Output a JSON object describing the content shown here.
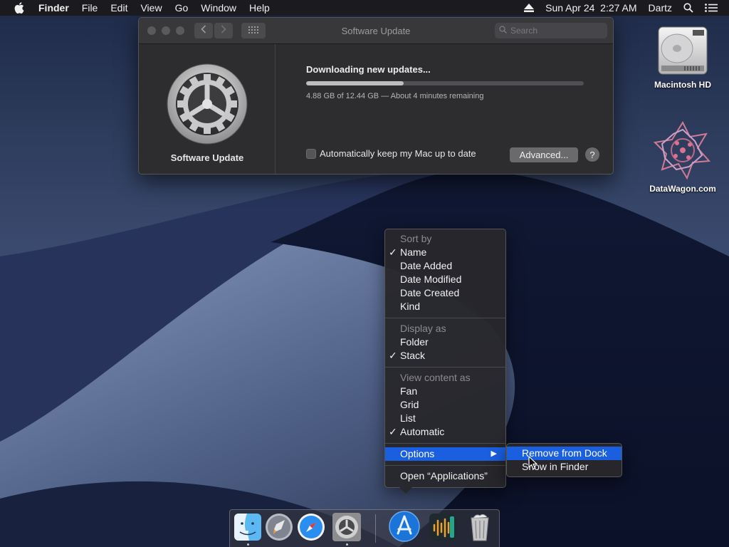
{
  "menubar": {
    "app_name": "Finder",
    "menus": [
      "File",
      "Edit",
      "View",
      "Go",
      "Window",
      "Help"
    ],
    "datetime": "Sun Apr 24  2:27 AM",
    "user": "Dartz"
  },
  "window": {
    "title": "Software Update",
    "search_placeholder": "Search",
    "app_name": "Software Update",
    "status_title": "Downloading new updates...",
    "progress_fraction": 0.35,
    "progress_text": "4.88 GB of 12.44 GB — About 4 minutes remaining",
    "auto_update_label": "Automatically keep my Mac up to date",
    "auto_update_checked": false,
    "advanced_label": "Advanced...",
    "help_label": "?"
  },
  "desktop": {
    "icons": [
      {
        "label": "Macintosh HD"
      },
      {
        "label": "DataWagon.com"
      }
    ]
  },
  "context_menu": {
    "sort_header": "Sort by",
    "sort_items": [
      "Name",
      "Date Added",
      "Date Modified",
      "Date Created",
      "Kind"
    ],
    "display_header": "Display as",
    "display_items": [
      "Folder",
      "Stack"
    ],
    "view_header": "View content as",
    "view_items": [
      "Fan",
      "Grid",
      "List",
      "Automatic"
    ],
    "options_label": "Options",
    "open_label": "Open “Applications”",
    "checkmark": "✓",
    "submenu_arrow": "▶"
  },
  "options_submenu": {
    "items": [
      "Remove from Dock",
      "Show in Finder"
    ]
  },
  "colors": {
    "highlight": "#1a5fe0"
  }
}
